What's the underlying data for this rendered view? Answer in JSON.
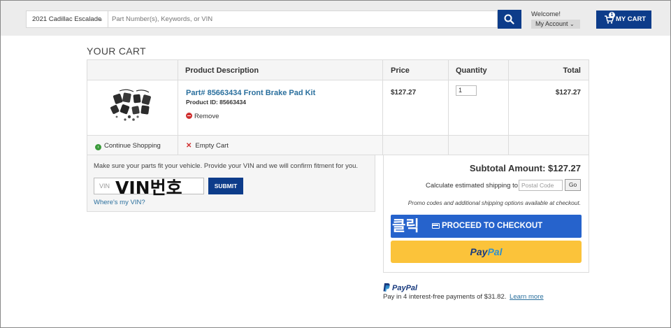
{
  "header": {
    "vehicle": "2021 Cadillac Escalade",
    "search_placeholder": "Part Number(s), Keywords, or VIN",
    "welcome": "Welcome!",
    "my_account": "My Account",
    "cart_label": "MY CART",
    "cart_count": "1",
    "accent_color": "#0d3c8a"
  },
  "cart": {
    "title": "YOUR CART",
    "columns": [
      "Product Description",
      "Price",
      "Quantity",
      "Total"
    ],
    "items": [
      {
        "name": "Part# 85663434 Front Brake Pad Kit",
        "product_id": "Product ID: 85663434",
        "remove_label": "Remove",
        "price": "$127.27",
        "quantity": "1",
        "total": "$127.27"
      }
    ],
    "continue_label": "Continue Shopping",
    "empty_label": "Empty Cart"
  },
  "vin": {
    "instructions": "Make sure your parts fit your vehicle. Provide your VIN and we will confirm fitment for you.",
    "placeholder": "VIN",
    "overlay": "VIN번호",
    "submit": "SUBMIT",
    "link": "Where's my VIN?"
  },
  "summary": {
    "subtotal": "Subtotal Amount: $127.27",
    "shipping_label": "Calculate estimated shipping to",
    "postal_placeholder": "Postal Code",
    "go": "Go",
    "promo_note": "Promo codes and additional shipping options available at checkout.",
    "checkout": "PROCEED TO CHECKOUT",
    "checkout_overlay": "클릭",
    "paypal_dark": "Pay",
    "paypal_light": "Pal"
  },
  "paypal_credit": {
    "brand": "PayPal",
    "text": "Pay in 4 interest-free payments of $31.82.",
    "learn_more": "Learn more"
  }
}
